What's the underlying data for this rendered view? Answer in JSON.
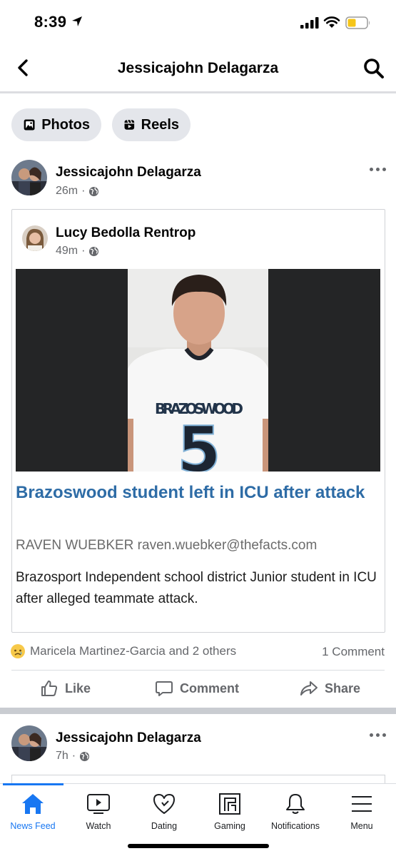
{
  "status_bar": {
    "time": "8:39"
  },
  "header": {
    "title": "Jessicajohn Delagarza"
  },
  "chips": [
    {
      "label": "Photos"
    },
    {
      "label": "Reels"
    }
  ],
  "post": {
    "author": "Jessicajohn Delagarza",
    "time": "26m",
    "shared": {
      "author": "Lucy Bedolla Rentrop",
      "time": "49m",
      "image_jersey_text": "BRAZOSWOOD",
      "image_jersey_number": "5",
      "headline": "Brazoswood student left in ICU after attack",
      "byline": "RAVEN WUEBKER raven.wuebker@thefacts.com",
      "summary": "Brazosport Independent school district Junior student in ICU after alleged teammate attack."
    },
    "reactions_text": "Maricela Martinez-Garcia and 2 others",
    "comments_text": "1 Comment",
    "actions": {
      "like": "Like",
      "comment": "Comment",
      "share": "Share"
    }
  },
  "post2": {
    "author": "Jessicajohn Delagarza",
    "time": "7h"
  },
  "tabbar": {
    "tabs": [
      {
        "label": "News Feed",
        "icon": "home-icon",
        "active": true
      },
      {
        "label": "Watch",
        "icon": "video-icon"
      },
      {
        "label": "Dating",
        "icon": "heart-icon"
      },
      {
        "label": "Gaming",
        "icon": "gaming-icon"
      },
      {
        "label": "Notifications",
        "icon": "bell-icon"
      },
      {
        "label": "Menu",
        "icon": "menu-icon"
      }
    ]
  },
  "colors": {
    "accent": "#1877f2",
    "headline": "#2e6ca6",
    "secondary_text": "#65676b",
    "battery": "#f5c518"
  }
}
